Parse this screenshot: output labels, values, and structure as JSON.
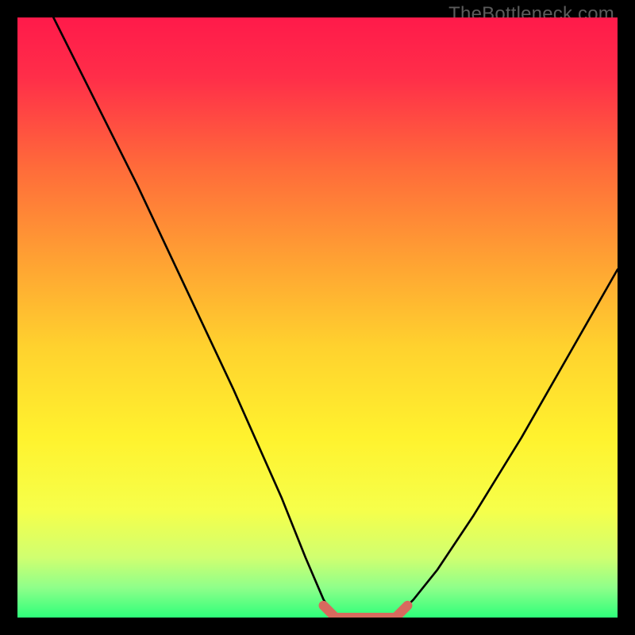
{
  "watermark": {
    "text": "TheBottleneck.com"
  },
  "gradient": {
    "stops": [
      {
        "offset": 0.0,
        "color": "#ff1a4a"
      },
      {
        "offset": 0.1,
        "color": "#ff2e49"
      },
      {
        "offset": 0.25,
        "color": "#ff6b3a"
      },
      {
        "offset": 0.4,
        "color": "#ffa033"
      },
      {
        "offset": 0.55,
        "color": "#ffd22e"
      },
      {
        "offset": 0.7,
        "color": "#fff22e"
      },
      {
        "offset": 0.82,
        "color": "#f6ff4a"
      },
      {
        "offset": 0.9,
        "color": "#d0ff70"
      },
      {
        "offset": 0.95,
        "color": "#8fff8a"
      },
      {
        "offset": 1.0,
        "color": "#2eff7a"
      }
    ]
  },
  "chart_data": {
    "type": "line",
    "title": "",
    "xlabel": "",
    "ylabel": "",
    "xlim": [
      0,
      100
    ],
    "ylim": [
      0,
      100
    ],
    "series": [
      {
        "name": "curve-left",
        "x": [
          6,
          12,
          20,
          28,
          36,
          44,
          48,
          51,
          53
        ],
        "y": [
          100,
          88,
          72,
          55,
          38,
          20,
          10,
          3,
          0
        ]
      },
      {
        "name": "curve-right",
        "x": [
          63,
          66,
          70,
          76,
          84,
          92,
          100
        ],
        "y": [
          0,
          3,
          8,
          17,
          30,
          44,
          58
        ]
      },
      {
        "name": "flat-bottom",
        "x": [
          53,
          55,
          57,
          59,
          61,
          63
        ],
        "y": [
          0,
          0,
          0,
          0,
          0,
          0
        ]
      }
    ],
    "highlight": {
      "name": "bottom-marker",
      "color": "#d86a5e",
      "x": [
        51,
        53,
        55,
        57,
        59,
        61,
        63,
        65
      ],
      "y": [
        2,
        0,
        0,
        0,
        0,
        0,
        0,
        2
      ]
    }
  }
}
